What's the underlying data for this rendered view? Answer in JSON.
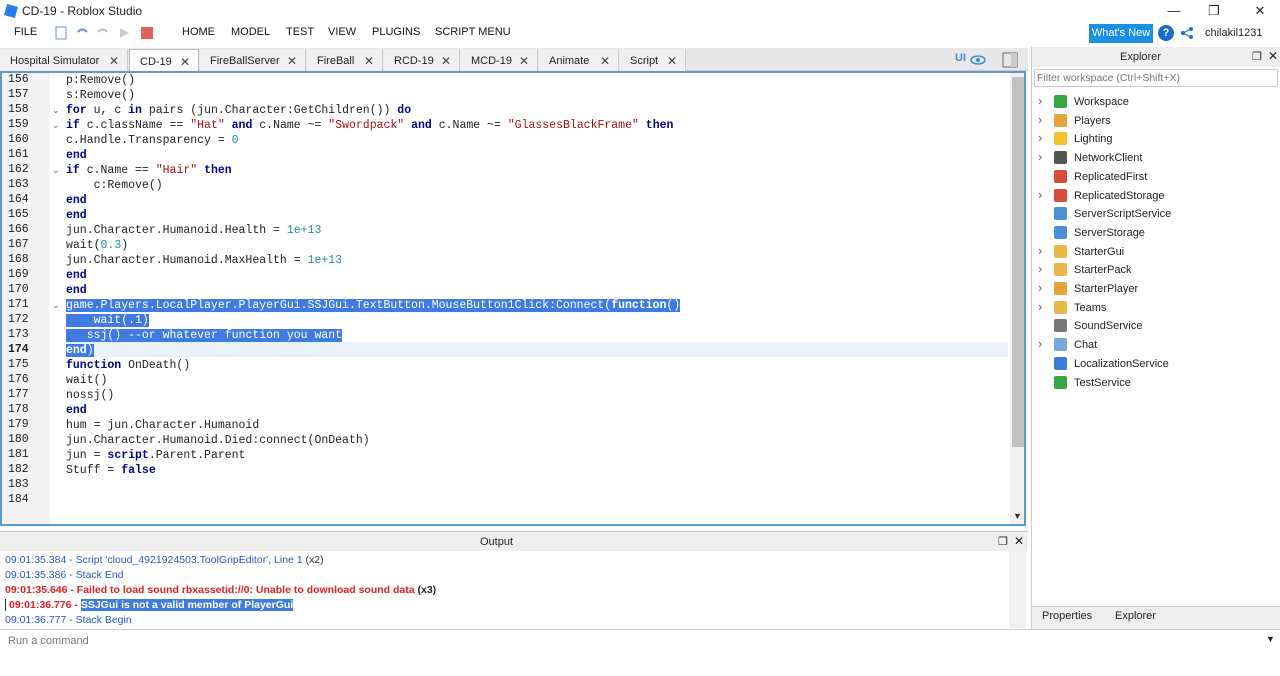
{
  "window": {
    "title": "CD-19 - Roblox Studio",
    "minimize": "—",
    "maximize": "❐",
    "close": "✕"
  },
  "menu": {
    "file": "FILE",
    "items": [
      "HOME",
      "MODEL",
      "TEST",
      "VIEW",
      "PLUGINS",
      "SCRIPT MENU"
    ]
  },
  "header": {
    "whats_new": "What's New",
    "help": "?",
    "username": "chilakil1231"
  },
  "tabs": [
    {
      "label": "Hospital Simulator"
    },
    {
      "label": "CD-19"
    },
    {
      "label": "FireBallServer"
    },
    {
      "label": "FireBall"
    },
    {
      "label": "RCD-19"
    },
    {
      "label": "MCD-19"
    },
    {
      "label": "Animate"
    },
    {
      "label": "Script"
    }
  ],
  "editor": {
    "ui_toggle": "UI",
    "line_numbers": [
      "156",
      "157",
      "158",
      "159",
      "160",
      "161",
      "162",
      "163",
      "164",
      "165",
      "166",
      "167",
      "168",
      "169",
      "170",
      "171",
      "172",
      "173",
      "174",
      "175",
      "176",
      "177",
      "178",
      "179",
      "180",
      "181",
      "182",
      "183",
      "184"
    ],
    "lines": [
      "p:Remove()",
      "s:Remove()",
      "for u, c in pairs (jun.Character:GetChildren()) do",
      "if c.className == \"Hat\" and c.Name ~= \"Swordpack\" and c.Name ~= \"GlassesBlackFrame\" then",
      "c.Handle.Transparency = 0",
      "end",
      "if c.Name == \"Hair\" then",
      "    c:Remove()",
      "end",
      "end",
      "jun.Character.Humanoid.Health = 1e+13",
      "wait(0.3)",
      "jun.Character.Humanoid.MaxHealth = 1e+13",
      "end",
      "end",
      "game.Players.LocalPlayer.PlayerGui.SSJGui.TextButton.MouseButton1Click:Connect(function()",
      "    wait(.1)",
      "   ssj() --or whatever function you want",
      "end)",
      "function OnDeath()",
      "wait()",
      "nossj()",
      "end",
      "hum = jun.Character.Humanoid",
      "jun.Character.Humanoid.Died:connect(OnDeath)",
      "jun = script.Parent.Parent",
      "Stuff = false",
      "",
      ""
    ]
  },
  "output": {
    "title": "Output",
    "lines": [
      {
        "time": "09:01:35.384",
        "text": " - Script 'cloud_4921924503.ToolGripEditor', Line 1",
        "suffix": " (x2)"
      },
      {
        "time": "09:01:35.386",
        "text": " - Stack End",
        "suffix": ""
      },
      {
        "time": "09:01:35.646",
        "text": " - Failed to load sound rbxassetid://0: Unable to download sound data",
        "suffix": " (x3)"
      },
      {
        "time": "09:01:36.776",
        "text": " - ",
        "suffix": "SSJGui is not a valid member of PlayerGui"
      },
      {
        "time": "09:01:36.777",
        "text": " - Stack Begin",
        "suffix": ""
      }
    ]
  },
  "command": {
    "placeholder": "Run a command"
  },
  "explorer": {
    "title": "Explorer",
    "filter_placeholder": "Filter workspace (Ctrl+Shift+X)",
    "items": [
      {
        "label": "Workspace",
        "icon": "workspace-icon",
        "color": "#3aa544",
        "expand": true
      },
      {
        "label": "Players",
        "icon": "players-icon",
        "color": "#e8a23a",
        "expand": true
      },
      {
        "label": "Lighting",
        "icon": "lighting-icon",
        "color": "#f2c230",
        "expand": true
      },
      {
        "label": "NetworkClient",
        "icon": "network-icon",
        "color": "#555555",
        "expand": true
      },
      {
        "label": "ReplicatedFirst",
        "icon": "replicated-first-icon",
        "color": "#d84a3a",
        "expand": false
      },
      {
        "label": "ReplicatedStorage",
        "icon": "replicated-storage-icon",
        "color": "#d84a3a",
        "expand": true
      },
      {
        "label": "ServerScriptService",
        "icon": "server-script-icon",
        "color": "#4a8fd8",
        "expand": false
      },
      {
        "label": "ServerStorage",
        "icon": "server-storage-icon",
        "color": "#4a8fd8",
        "expand": false
      },
      {
        "label": "StarterGui",
        "icon": "starter-gui-icon",
        "color": "#e8b84a",
        "expand": true
      },
      {
        "label": "StarterPack",
        "icon": "starter-pack-icon",
        "color": "#e8b84a",
        "expand": true
      },
      {
        "label": "StarterPlayer",
        "icon": "starter-player-icon",
        "color": "#e8a23a",
        "expand": true
      },
      {
        "label": "Teams",
        "icon": "teams-icon",
        "color": "#e8b84a",
        "expand": true
      },
      {
        "label": "SoundService",
        "icon": "sound-icon",
        "color": "#777777",
        "expand": false
      },
      {
        "label": "Chat",
        "icon": "chat-icon",
        "color": "#7aa6d8",
        "expand": true
      },
      {
        "label": "LocalizationService",
        "icon": "localization-icon",
        "color": "#3a7bd8",
        "expand": false
      },
      {
        "label": "TestService",
        "icon": "test-icon",
        "color": "#3aa544",
        "expand": false
      }
    ],
    "bottom_tabs": [
      "Properties",
      "Explorer"
    ]
  }
}
